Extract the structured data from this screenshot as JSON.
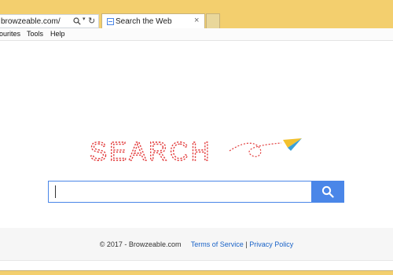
{
  "browser": {
    "address_url": "browzeable.com/",
    "tab_title": "Search the Web",
    "tab_close": "×",
    "refresh_glyph": "↻",
    "dropdown_glyph": "▾"
  },
  "menu": {
    "items": [
      "Favourites",
      "Tools",
      "Help"
    ],
    "visible_items": [
      "ourites",
      "Tools",
      "Help"
    ]
  },
  "logo": {
    "text": "SEARCH",
    "color": "#e23b3b",
    "icon": "paper-plane-icon"
  },
  "search": {
    "placeholder": "",
    "value": "",
    "button_icon": "search-icon",
    "accent": "#4a86e8"
  },
  "footer": {
    "copyright": "© 2017 - Browzeable.com",
    "terms": "Terms of Service",
    "separator": "|",
    "privacy": "Privacy Policy"
  },
  "colors": {
    "chrome": "#f3cf6e",
    "link": "#1a63c8"
  }
}
